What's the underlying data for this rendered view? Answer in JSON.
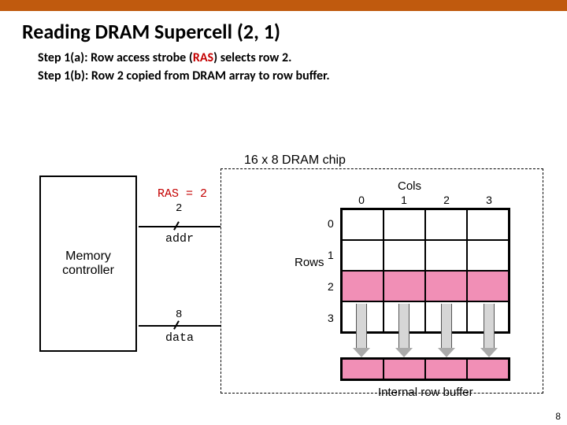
{
  "title": "Reading DRAM Supercell (2, 1)",
  "steps": {
    "a_pre": "Step 1(a): Row access strobe (",
    "a_ras": "RAS",
    "a_post": ") selects row 2.",
    "b": "Step 1(b): Row 2 copied from DRAM array to row buffer."
  },
  "chip_label": "16 x 8 DRAM chip",
  "mem_ctrl": "Memory\ncontroller",
  "ras_label": "RAS = 2",
  "addr_bits": "2",
  "addr_name": "addr",
  "data_bits": "8",
  "data_name": "data",
  "cols_word": "Cols",
  "rows_word": "Rows",
  "cols": [
    "0",
    "1",
    "2",
    "3"
  ],
  "rows": [
    "0",
    "1",
    "2",
    "3"
  ],
  "buf_label": "Internal row buffer",
  "page_num": "8",
  "chart_data": {
    "type": "table",
    "title": "DRAM 4x4 supercell array — RAS selects row 2, copied to row buffer",
    "grid_rows": 4,
    "grid_cols": 4,
    "highlighted_row": 2,
    "row_buffer_source_row": 2,
    "addr_bus_width_bits": 2,
    "data_bus_width_bits": 8
  }
}
